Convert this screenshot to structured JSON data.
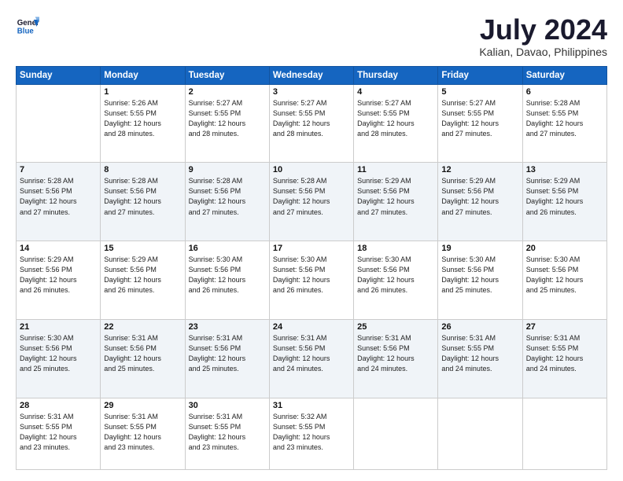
{
  "header": {
    "logo_line1": "General",
    "logo_line2": "Blue",
    "month_title": "July 2024",
    "location": "Kalian, Davao, Philippines"
  },
  "days_of_week": [
    "Sunday",
    "Monday",
    "Tuesday",
    "Wednesday",
    "Thursday",
    "Friday",
    "Saturday"
  ],
  "weeks": [
    [
      {
        "day": "",
        "info": ""
      },
      {
        "day": "1",
        "info": "Sunrise: 5:26 AM\nSunset: 5:55 PM\nDaylight: 12 hours\nand 28 minutes."
      },
      {
        "day": "2",
        "info": "Sunrise: 5:27 AM\nSunset: 5:55 PM\nDaylight: 12 hours\nand 28 minutes."
      },
      {
        "day": "3",
        "info": "Sunrise: 5:27 AM\nSunset: 5:55 PM\nDaylight: 12 hours\nand 28 minutes."
      },
      {
        "day": "4",
        "info": "Sunrise: 5:27 AM\nSunset: 5:55 PM\nDaylight: 12 hours\nand 28 minutes."
      },
      {
        "day": "5",
        "info": "Sunrise: 5:27 AM\nSunset: 5:55 PM\nDaylight: 12 hours\nand 27 minutes."
      },
      {
        "day": "6",
        "info": "Sunrise: 5:28 AM\nSunset: 5:55 PM\nDaylight: 12 hours\nand 27 minutes."
      }
    ],
    [
      {
        "day": "7",
        "info": "Sunrise: 5:28 AM\nSunset: 5:56 PM\nDaylight: 12 hours\nand 27 minutes."
      },
      {
        "day": "8",
        "info": "Sunrise: 5:28 AM\nSunset: 5:56 PM\nDaylight: 12 hours\nand 27 minutes."
      },
      {
        "day": "9",
        "info": "Sunrise: 5:28 AM\nSunset: 5:56 PM\nDaylight: 12 hours\nand 27 minutes."
      },
      {
        "day": "10",
        "info": "Sunrise: 5:28 AM\nSunset: 5:56 PM\nDaylight: 12 hours\nand 27 minutes."
      },
      {
        "day": "11",
        "info": "Sunrise: 5:29 AM\nSunset: 5:56 PM\nDaylight: 12 hours\nand 27 minutes."
      },
      {
        "day": "12",
        "info": "Sunrise: 5:29 AM\nSunset: 5:56 PM\nDaylight: 12 hours\nand 27 minutes."
      },
      {
        "day": "13",
        "info": "Sunrise: 5:29 AM\nSunset: 5:56 PM\nDaylight: 12 hours\nand 26 minutes."
      }
    ],
    [
      {
        "day": "14",
        "info": "Sunrise: 5:29 AM\nSunset: 5:56 PM\nDaylight: 12 hours\nand 26 minutes."
      },
      {
        "day": "15",
        "info": "Sunrise: 5:29 AM\nSunset: 5:56 PM\nDaylight: 12 hours\nand 26 minutes."
      },
      {
        "day": "16",
        "info": "Sunrise: 5:30 AM\nSunset: 5:56 PM\nDaylight: 12 hours\nand 26 minutes."
      },
      {
        "day": "17",
        "info": "Sunrise: 5:30 AM\nSunset: 5:56 PM\nDaylight: 12 hours\nand 26 minutes."
      },
      {
        "day": "18",
        "info": "Sunrise: 5:30 AM\nSunset: 5:56 PM\nDaylight: 12 hours\nand 26 minutes."
      },
      {
        "day": "19",
        "info": "Sunrise: 5:30 AM\nSunset: 5:56 PM\nDaylight: 12 hours\nand 25 minutes."
      },
      {
        "day": "20",
        "info": "Sunrise: 5:30 AM\nSunset: 5:56 PM\nDaylight: 12 hours\nand 25 minutes."
      }
    ],
    [
      {
        "day": "21",
        "info": "Sunrise: 5:30 AM\nSunset: 5:56 PM\nDaylight: 12 hours\nand 25 minutes."
      },
      {
        "day": "22",
        "info": "Sunrise: 5:31 AM\nSunset: 5:56 PM\nDaylight: 12 hours\nand 25 minutes."
      },
      {
        "day": "23",
        "info": "Sunrise: 5:31 AM\nSunset: 5:56 PM\nDaylight: 12 hours\nand 25 minutes."
      },
      {
        "day": "24",
        "info": "Sunrise: 5:31 AM\nSunset: 5:56 PM\nDaylight: 12 hours\nand 24 minutes."
      },
      {
        "day": "25",
        "info": "Sunrise: 5:31 AM\nSunset: 5:56 PM\nDaylight: 12 hours\nand 24 minutes."
      },
      {
        "day": "26",
        "info": "Sunrise: 5:31 AM\nSunset: 5:55 PM\nDaylight: 12 hours\nand 24 minutes."
      },
      {
        "day": "27",
        "info": "Sunrise: 5:31 AM\nSunset: 5:55 PM\nDaylight: 12 hours\nand 24 minutes."
      }
    ],
    [
      {
        "day": "28",
        "info": "Sunrise: 5:31 AM\nSunset: 5:55 PM\nDaylight: 12 hours\nand 23 minutes."
      },
      {
        "day": "29",
        "info": "Sunrise: 5:31 AM\nSunset: 5:55 PM\nDaylight: 12 hours\nand 23 minutes."
      },
      {
        "day": "30",
        "info": "Sunrise: 5:31 AM\nSunset: 5:55 PM\nDaylight: 12 hours\nand 23 minutes."
      },
      {
        "day": "31",
        "info": "Sunrise: 5:32 AM\nSunset: 5:55 PM\nDaylight: 12 hours\nand 23 minutes."
      },
      {
        "day": "",
        "info": ""
      },
      {
        "day": "",
        "info": ""
      },
      {
        "day": "",
        "info": ""
      }
    ]
  ]
}
